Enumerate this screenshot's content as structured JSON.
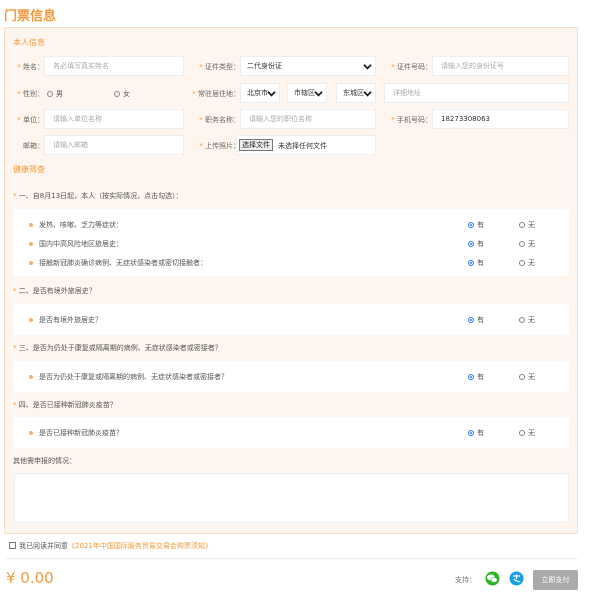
{
  "page_title": "门票信息",
  "section_personal": "本人信息",
  "fields": {
    "name": {
      "label": "姓名：",
      "placeholder": "务必填写真实姓名"
    },
    "id_type": {
      "label": "证件类型：",
      "value": "二代身份证"
    },
    "id_number": {
      "label": "证件号码：",
      "placeholder": "请输入您的身份证号"
    },
    "gender": {
      "label": "性别：",
      "male": "男",
      "female": "女"
    },
    "address": {
      "label": "常驻居住地：",
      "province": "北京市",
      "city": "市辖区",
      "district": "东城区",
      "detail_placeholder": "详细地址"
    },
    "company": {
      "label": "单位：",
      "placeholder": "请输入单位名称"
    },
    "job": {
      "label": "职务名称：",
      "placeholder": "请输入您的职位名称"
    },
    "phone": {
      "label": "手机号码：",
      "value": "18273308063"
    },
    "email": {
      "label": "邮箱：",
      "placeholder": "请输入邮箱"
    },
    "photo": {
      "label": "上传照片：",
      "button": "选择文件",
      "status": "未选择任何文件"
    }
  },
  "section_health": "健康筛查",
  "questions": [
    {
      "title": "一、自8月13日起，本人（按实际情况，点击勾选）：",
      "items": [
        "发热、咳嗽、乏力等症状：",
        "国内中高风险地区旅居史：",
        "接触新冠肺炎确诊病例、无症状感染者或密切接触者："
      ]
    },
    {
      "title": "二、是否有境外旅居史？",
      "items": [
        "是否有境外旅居史？"
      ]
    },
    {
      "title": "三、是否为仍处于康复或隔离期的病例、无症状感染者或密接者？",
      "items": [
        "是否为仍处于康复或隔离期的病例、无症状感染者或密接者？"
      ]
    },
    {
      "title": "四、是否已接种新冠肺炎疫苗？",
      "items": [
        "是否已接种新冠肺炎疫苗？"
      ]
    }
  ],
  "option_yes": "有",
  "option_no": "无",
  "other_label": "其他需申报的情况：",
  "agree_prefix": "我已阅读并同意",
  "agree_link": "《2021年中国国际服务贸易交易会购票须知》",
  "price": "¥ 0.00",
  "support_label": "支持：",
  "pay_button": "立即支付",
  "colors": {
    "accent": "#f39a3c",
    "radio_on": "#2d7ff9",
    "wechat": "#2bb62a",
    "alipay": "#1a9fe6"
  }
}
